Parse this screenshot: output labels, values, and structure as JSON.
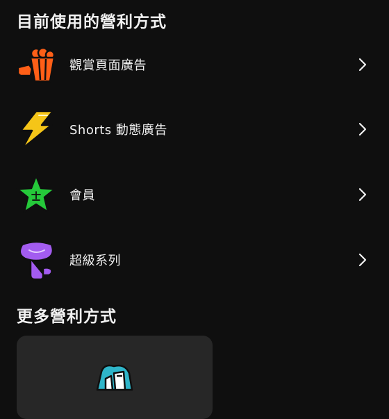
{
  "current_section": {
    "title": "目前使用的營利方式",
    "items": [
      {
        "label": "觀賞頁面廣告",
        "icon": "popcorn-icon"
      },
      {
        "label": "Shorts 動態廣告",
        "icon": "lightning-icon"
      },
      {
        "label": "會員",
        "icon": "star-icon"
      },
      {
        "label": "超級系列",
        "icon": "flower-icon"
      }
    ]
  },
  "more_section": {
    "title": "更多營利方式",
    "card_icon": "shopping-bag-icon"
  },
  "colors": {
    "background": "#0f0f0f",
    "card": "#272727",
    "text": "#f1f1f1",
    "popcorn": "#ff5f17",
    "lightning": "#f5c518",
    "star": "#25c93a",
    "flower": "#a35cf0",
    "bag_accent": "#2fb5c9"
  }
}
